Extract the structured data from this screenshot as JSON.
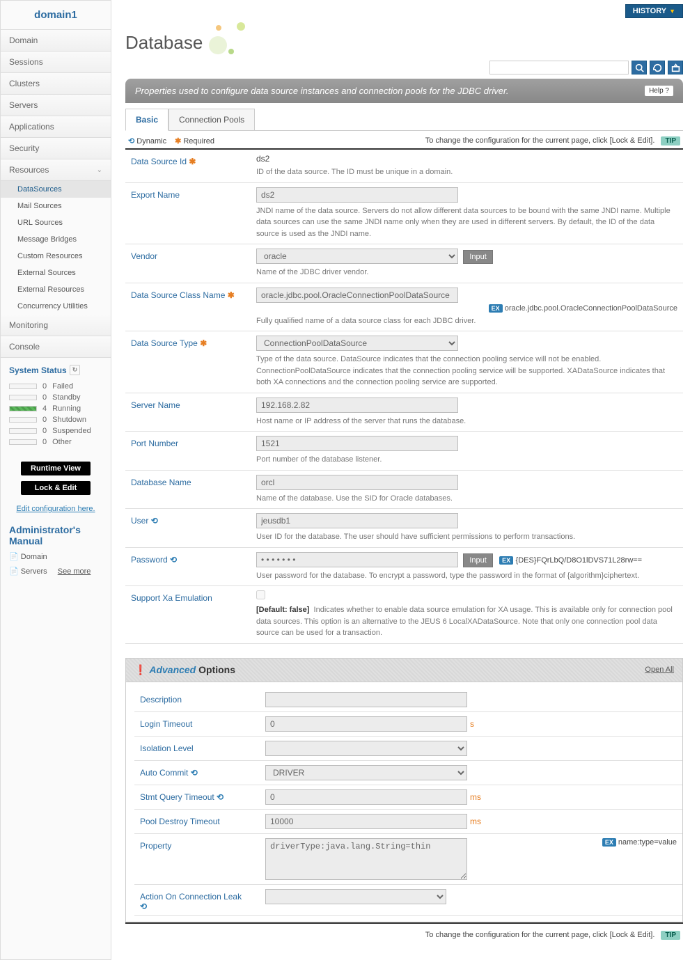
{
  "domain_name": "domain1",
  "nav": {
    "items": [
      "Domain",
      "Sessions",
      "Clusters",
      "Servers",
      "Applications",
      "Security"
    ],
    "resources_label": "Resources",
    "resources_sub": [
      "DataSources",
      "Mail Sources",
      "URL Sources",
      "Message Bridges",
      "Custom Resources",
      "External Sources",
      "External Resources",
      "Concurrency Utilities"
    ],
    "tail": [
      "Monitoring",
      "Console"
    ]
  },
  "status": {
    "title": "System Status",
    "rows": [
      {
        "n": "0",
        "label": "Failed"
      },
      {
        "n": "0",
        "label": "Standby"
      },
      {
        "n": "4",
        "label": "Running"
      },
      {
        "n": "0",
        "label": "Shutdown"
      },
      {
        "n": "0",
        "label": "Suspended"
      },
      {
        "n": "0",
        "label": "Other"
      }
    ]
  },
  "buttons": {
    "runtime": "Runtime View",
    "lock": "Lock & Edit",
    "edit_link": "Edit configuration here."
  },
  "manual": {
    "title": "Administrator's Manual",
    "items": [
      "Domain",
      "Servers"
    ],
    "see_more": "See more"
  },
  "header": {
    "history": "HISTORY",
    "page_title": "Database",
    "help": "Help"
  },
  "desc_bar": "Properties used to configure data source instances and connection pools for the JDBC driver.",
  "tabs": {
    "basic": "Basic",
    "pools": "Connection Pools"
  },
  "legend": {
    "dynamic": "Dynamic",
    "required": "Required",
    "change_text": "To change the configuration for the current page, click [Lock & Edit].",
    "tip": "TIP"
  },
  "fields": {
    "data_source_id": {
      "label": "Data Source Id",
      "value": "ds2",
      "desc": "ID of the data source. The ID must be unique in a domain."
    },
    "export_name": {
      "label": "Export Name",
      "value": "ds2",
      "desc": "JNDI name of the data source. Servers do not allow different data sources to be bound with the same JNDI name. Multiple data sources can use the same JNDI name only when they are used in different servers. By default, the ID of the data source is used as the JNDI name."
    },
    "vendor": {
      "label": "Vendor",
      "value": "oracle",
      "btn": "Input",
      "desc": "Name of the JDBC driver vendor."
    },
    "class_name": {
      "label": "Data Source Class Name",
      "value": "oracle.jdbc.pool.OracleConnectionPoolDataSource",
      "ex": "oracle.jdbc.pool.OracleConnectionPoolDataSource",
      "desc": "Fully qualified name of a data source class for each JDBC driver."
    },
    "ds_type": {
      "label": "Data Source Type",
      "value": "ConnectionPoolDataSource",
      "desc": "Type of the data source. DataSource indicates that the connection pooling service will not be enabled. ConnectionPoolDataSource indicates that the connection pooling service will be supported. XADataSource indicates that both XA connections and the connection pooling service are supported."
    },
    "server_name": {
      "label": "Server Name",
      "value": "192.168.2.82",
      "desc": "Host name or IP address of the server that runs the database."
    },
    "port": {
      "label": "Port Number",
      "value": "1521",
      "desc": "Port number of the database listener."
    },
    "db_name": {
      "label": "Database Name",
      "value": "orcl",
      "desc": "Name of the database. Use the SID for Oracle databases."
    },
    "user": {
      "label": "User",
      "value": "jeusdb1",
      "desc": "User ID for the database. The user should have sufficient permissions to perform transactions."
    },
    "password": {
      "label": "Password",
      "value": "• • • • • • •",
      "btn": "Input",
      "ex": "{DES}FQrLbQ/D8O1lDVS71L28rw==",
      "desc": "User password for the database. To encrypt a password, type the password in the format of {algorithm}ciphertext."
    },
    "xa_emu": {
      "label": "Support Xa Emulation",
      "default": "[Default: false]",
      "desc": "Indicates whether to enable data source emulation for XA usage. This is available only for connection pool data sources. This option is an alternative to the JEUS 6 LocalXADataSource. Note that only one connection pool data source can be used for a transaction."
    }
  },
  "advanced": {
    "title_adv": "Advanced",
    "title_opts": " Options",
    "open_all": "Open All",
    "description": {
      "label": "Description",
      "value": ""
    },
    "login_timeout": {
      "label": "Login Timeout",
      "value": "0",
      "unit": "s"
    },
    "isolation": {
      "label": "Isolation Level",
      "value": ""
    },
    "auto_commit": {
      "label": "Auto Commit",
      "value": "DRIVER"
    },
    "stmt_timeout": {
      "label": "Stmt Query Timeout",
      "value": "0",
      "unit": "ms"
    },
    "pool_destroy": {
      "label": "Pool Destroy Timeout",
      "value": "10000",
      "unit": "ms"
    },
    "property": {
      "label": "Property",
      "value": "driverType:java.lang.String=thin",
      "ex": "name:type=value"
    },
    "action_leak": {
      "label": "Action On Connection Leak",
      "value": ""
    }
  },
  "ex_label": "EX"
}
